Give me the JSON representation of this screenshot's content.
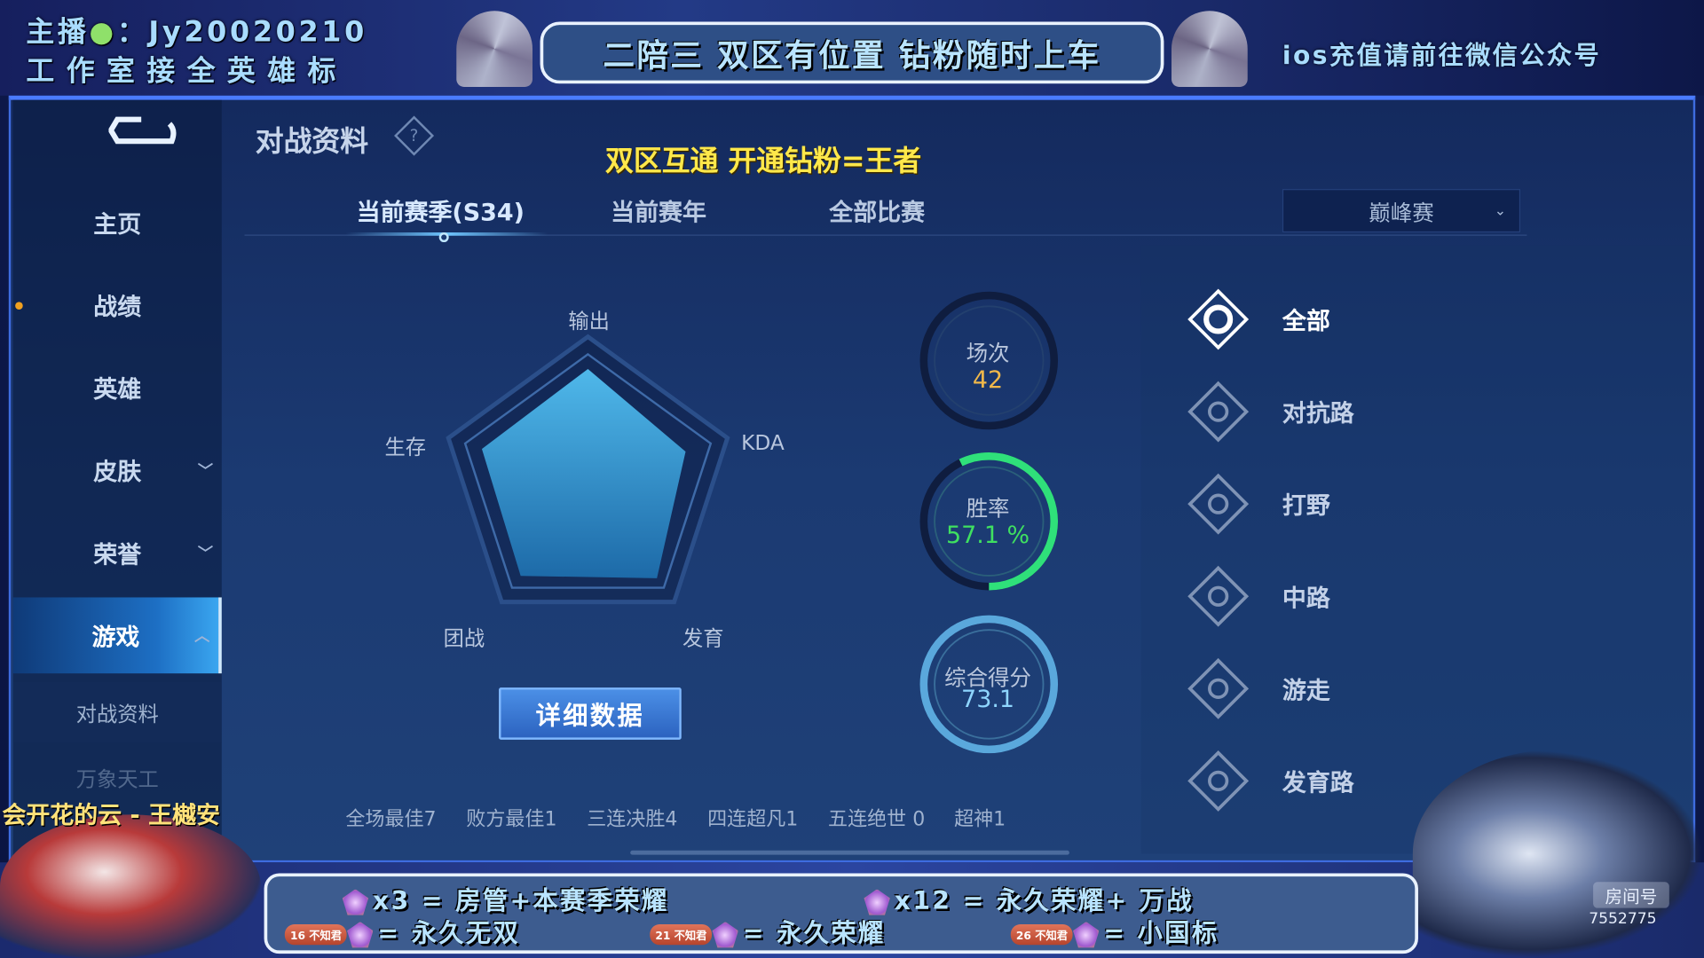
{
  "overlay": {
    "streamer_line1": "主播",
    "streamer_id": "：Jy20020210",
    "streamer_line2": "工作室接全英雄标",
    "banner": "二陪三  双区有位置 钻粉随时上车",
    "ios_note": "ios充值请前往微信公众号",
    "promo": "双区互通 开通钻粉=王者",
    "song": "会开花的云 - 王樾安",
    "room_label": "房间号",
    "room_number": "7552775",
    "rewards": [
      {
        "badge": "",
        "qty": "x3",
        "text": "= 房管+本赛季荣耀"
      },
      {
        "badge": "",
        "qty": "x12",
        "text": "= 永久荣耀+ 万战"
      },
      {
        "badge": "16 不知君",
        "qty": "",
        "text": "= 永久无双"
      },
      {
        "badge": "21 不知君",
        "qty": "",
        "text": "= 永久荣耀"
      },
      {
        "badge": "26 不知君",
        "qty": "",
        "text": "= 小国标"
      }
    ]
  },
  "sidebar": {
    "items": [
      {
        "label": "主页"
      },
      {
        "label": "战绩"
      },
      {
        "label": "英雄"
      },
      {
        "label": "皮肤",
        "chevron": "chevron-down"
      },
      {
        "label": "荣誉",
        "chevron": "chevron-down"
      },
      {
        "label": "游戏",
        "chevron": "chevron-up",
        "active": true
      }
    ],
    "subitems": [
      {
        "label": "对战资料",
        "active": true
      },
      {
        "label": "万象天工"
      }
    ]
  },
  "header": {
    "title": "对战资料",
    "help": "?"
  },
  "tabs": [
    {
      "label": "当前赛季(S34)",
      "active": true
    },
    {
      "label": "当前赛年"
    },
    {
      "label": "全部比赛"
    }
  ],
  "mode_select": {
    "value": "巅峰赛"
  },
  "radar": {
    "labels": [
      "输出",
      "KDA",
      "发育",
      "团战",
      "生存"
    ],
    "values": [
      0.78,
      0.7,
      0.8,
      0.78,
      0.76
    ]
  },
  "circles": {
    "matches": {
      "label": "场次",
      "value": "42"
    },
    "winrate": {
      "label": "胜率",
      "value": "57.1 %",
      "fraction": 0.571
    },
    "score": {
      "label": "综合得分",
      "value": "73.1"
    }
  },
  "detail_button": "详细数据",
  "stats": [
    "全场最佳7",
    "败方最佳1",
    "三连决胜4",
    "四连超凡1",
    "五连绝世 0",
    "超神1"
  ],
  "roles": [
    {
      "label": "全部",
      "icon": "all-icon",
      "active": true
    },
    {
      "label": "对抗路",
      "icon": "clash-lane-icon"
    },
    {
      "label": "打野",
      "icon": "jungle-icon"
    },
    {
      "label": "中路",
      "icon": "mid-lane-icon"
    },
    {
      "label": "游走",
      "icon": "roam-icon"
    },
    {
      "label": "发育路",
      "icon": "farm-lane-icon"
    }
  ],
  "colors": {
    "accent": "#3aa6f0",
    "win": "#2fe07a",
    "matches": "#f0b84a",
    "score": "#7fd0ff",
    "promo": "#ffe84a"
  }
}
